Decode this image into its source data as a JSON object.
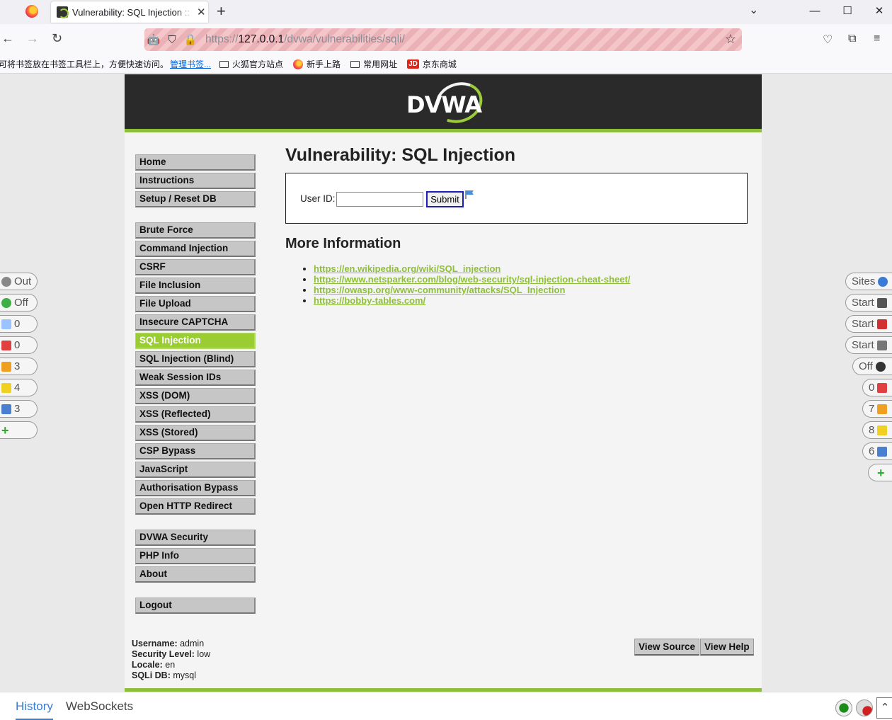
{
  "browser": {
    "tab_title": "Vulnerability: SQL Injection ::",
    "url_prefix": "https://",
    "url_host": "127.0.0.1",
    "url_path": "/dvwa/vulnerabilities/sqli/",
    "bookmarks_hint": "可将书签放在书签工具栏上，方便快速访问。",
    "bookmarks_manage": "管理书签...",
    "bookmarks": [
      "火狐官方站点",
      "新手上路",
      "常用网址",
      "京东商城"
    ]
  },
  "dvwa": {
    "logo": "DVWA",
    "menu_groups": [
      [
        "Home",
        "Instructions",
        "Setup / Reset DB"
      ],
      [
        "Brute Force",
        "Command Injection",
        "CSRF",
        "File Inclusion",
        "File Upload",
        "Insecure CAPTCHA",
        "SQL Injection",
        "SQL Injection (Blind)",
        "Weak Session IDs",
        "XSS (DOM)",
        "XSS (Reflected)",
        "XSS (Stored)",
        "CSP Bypass",
        "JavaScript",
        "Authorisation Bypass",
        "Open HTTP Redirect"
      ],
      [
        "DVWA Security",
        "PHP Info",
        "About"
      ],
      [
        "Logout"
      ]
    ],
    "selected_menu": "SQL Injection",
    "page_title": "Vulnerability: SQL Injection",
    "form": {
      "user_id_label": "User ID:",
      "user_id_value": "",
      "submit_label": "Submit"
    },
    "more_info_title": "More Information",
    "links": [
      "https://en.wikipedia.org/wiki/SQL_injection",
      "https://www.netsparker.com/blog/web-security/sql-injection-cheat-sheet/",
      "https://owasp.org/www-community/attacks/SQL_Injection",
      "https://bobby-tables.com/"
    ],
    "footer": {
      "username_label": "Username:",
      "username": "admin",
      "security_label": "Security Level:",
      "security": "low",
      "locale_label": "Locale:",
      "locale": "en",
      "sqli_label": "SQLi DB:",
      "sqli": "mysql"
    },
    "view_source": "View Source",
    "view_help": "View Help"
  },
  "hud": {
    "left": [
      "Out",
      "Off",
      "0",
      "0",
      "3",
      "4",
      "3"
    ],
    "right": [
      "Sites",
      "Start",
      "Start",
      "Start",
      "Off",
      "0",
      "7",
      "8",
      "6"
    ],
    "left_icon_colors": [
      "#888888",
      "#3cb043",
      "#9ac3ff",
      "#e04040",
      "#f0a020",
      "#f0d020",
      "#4a7fd0",
      "#2eaa2e"
    ],
    "right_icon_colors": [
      "#3a7bd5",
      "#555555",
      "#d03030",
      "#777777",
      "#333333",
      "#e04040",
      "#f0a020",
      "#f0d020",
      "#4a7fd0",
      "#2eaa2e"
    ]
  },
  "bottom": {
    "history": "History",
    "websockets": "WebSockets"
  }
}
